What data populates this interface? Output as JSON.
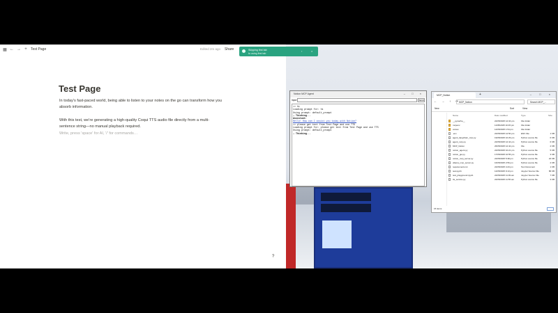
{
  "notion": {
    "breadcrumb": "Test Page",
    "edited": "Edited 2m ago",
    "share": "Share",
    "title": "Test Page",
    "paragraphs": [
      "In today's fast-paced world, being able to listen to your notes on the go can transform how you absorb information.",
      "With this test, we're generating a high-quality Coqui TTS audio file directly from a multi-sentence string—no manual playback required."
    ],
    "placeholder": "Write, press 'space' for AI, '/' for commands…",
    "help": "?"
  },
  "toast": {
    "line1": "Skipping first tab",
    "line2": "to using first tab",
    "color": "#2aa380"
  },
  "terminal": {
    "title": "Notion MCP Agent",
    "input_label": "Input:",
    "send": "Send",
    "lines": [
      {
        "text": ">> hi",
        "c": ""
      },
      {
        "text": "Loading prompt for: hi",
        "c": ""
      },
      {
        "text": "Using prompt: default_prompt",
        "c": ""
      },
      {
        "text": "⇢ Thinking...",
        "c": "b"
      },
      {
        "text": "Assistant:",
        "c": "b"
      },
      {
        "text": "Hello! How can I assist you today with Notion?",
        "c": "blue"
      },
      {
        "text": ">> please get text from Test Page and use TTS",
        "c": ""
      },
      {
        "text": "Loading prompt for: please get text from Test Page and use TTS",
        "c": ""
      },
      {
        "text": "Using prompt: default_prompt",
        "c": ""
      },
      {
        "text": "⇢ Thinking...",
        "c": "b"
      }
    ]
  },
  "explorer": {
    "tab": "MCP_Notion",
    "path": "MCP_Notion",
    "search": "Search MCP_...",
    "toolbar": [
      "New",
      "Sort",
      "View"
    ],
    "columns": [
      "Name",
      "Date modified",
      "Type",
      "Size"
    ],
    "files": [
      {
        "name": "__pycache__",
        "date": "22/05/2025 12:34 pm",
        "type": "File folder",
        "size": "",
        "folder": true
      },
      {
        "name": "mcpenv",
        "date": "11/05/2025 10:45 pm",
        "type": "File folder",
        "size": "",
        "folder": true
      },
      {
        "name": "voices",
        "date": "12/05/2025 1:54 pm",
        "type": "File folder",
        "size": "",
        "folder": true
      },
      {
        "name": ".env",
        "date": "22/05/2025 12:50 pm",
        "type": "ENV File",
        "size": "1 KB",
        "folder": false
      },
      {
        "name": "agent_langchain_mcp.py",
        "date": "19/05/2025 10:29 pm",
        "type": "Python source file",
        "size": "6 KB",
        "folder": false
      },
      {
        "name": "agent_mcp.py",
        "date": "22/05/2025 12:44 pm",
        "type": "Python source file",
        "size": "6 KB",
        "folder": false
      },
      {
        "name": "MCP_Notion",
        "date": "26/05/2025 12:42 pm",
        "type": "File",
        "size": "2 KB",
        "folder": false
      },
      {
        "name": "notion_agent.py",
        "date": "22/05/2025 10:21 pm",
        "type": "Python source file",
        "size": "5 KB",
        "folder": false
      },
      {
        "name": "notion_gui.py",
        "date": "17/05/2025 10:55 pm",
        "type": "Python source file",
        "size": "3 KB",
        "folder": false
      },
      {
        "name": "notion_mcp_server.py",
        "date": "22/05/2025 5:38 pm",
        "type": "Python source file",
        "size": "22 KB",
        "folder": false
      },
      {
        "name": "ollama_mcp_server.py",
        "date": "16/05/2025 2:56 pm",
        "type": "Python source file",
        "size": "2 KB",
        "folder": false
      },
      {
        "name": "requirements.txt",
        "date": "22/05/2025 4:23 pm",
        "type": "Text Document",
        "size": "1 KB",
        "folder": false
      },
      {
        "name": "test.ipynb",
        "date": "12/05/2025 9:13 pm",
        "type": "Jupyter Source File",
        "size": "86 KB",
        "folder": false
      },
      {
        "name": "test_playground.ipynb",
        "date": "22/05/2025 11:09 am",
        "type": "Jupyter Source File",
        "size": "7 KB",
        "folder": false
      },
      {
        "name": "tts_service.py",
        "date": "22/05/2025 11:55 am",
        "type": "Python source file",
        "size": "3 KB",
        "folder": false
      }
    ],
    "status": "15 items"
  }
}
